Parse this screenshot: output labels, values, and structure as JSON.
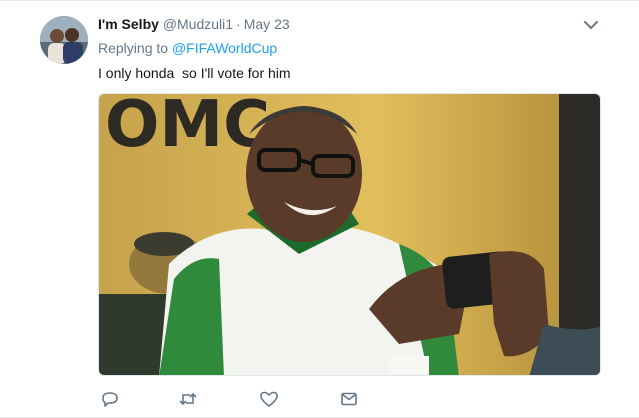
{
  "tweet": {
    "display_name": "I'm Selby",
    "handle": "@Mudzuli1",
    "separator": "·",
    "timestamp": "May 23",
    "replying_prefix": "Replying to",
    "replying_to": "@FIFAWorldCup",
    "text": "I only honda  so I'll vote for him",
    "media_alt": "Man in green and white shirt laughing while taking a photo with a phone",
    "media_sign_text": "OMC"
  },
  "actions": [
    {
      "name": "reply-icon"
    },
    {
      "name": "retweet-icon"
    },
    {
      "name": "like-icon"
    },
    {
      "name": "direct-message-icon"
    }
  ],
  "colors": {
    "link": "#1da1f2",
    "secondary_text": "#657786",
    "primary_text": "#14171a",
    "divider": "#e6ecf0"
  }
}
